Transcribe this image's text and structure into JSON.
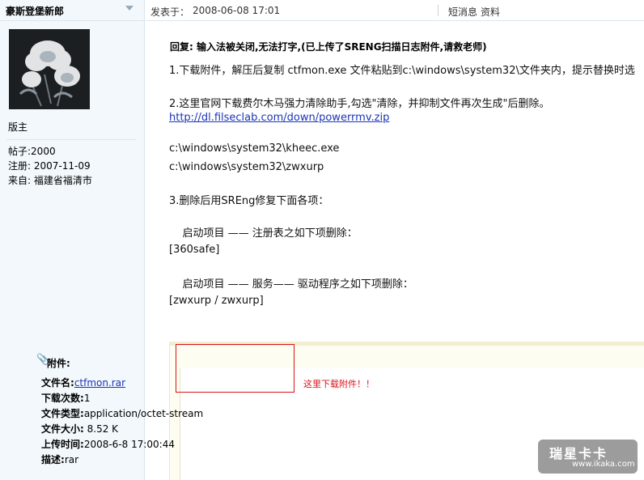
{
  "sidebar": {
    "username": "豪斯登堡新郎",
    "rank": "版主",
    "stats": [
      {
        "key": "帖子:",
        "value": "2000"
      },
      {
        "key": "注册:",
        "value": "2007-11-09"
      },
      {
        "key": "来自:",
        "value": "福建省福清市"
      }
    ]
  },
  "post": {
    "time_label": "发表于：",
    "time": "2008-06-08 17:01",
    "pm": "短消息",
    "profile": "资料",
    "title": "回复: 输入法被关闭,无法打字,(已上传了SRENG扫描日志附件,请救老师)",
    "lines": [
      "1.下载附件，解压后复制 ctfmon.exe 文件粘贴到c:\\windows\\system32\\文件夹内，提示替换时选",
      "2.这里官网下载费尔木马强力清除助手,勾选\"清除，并抑制文件再次生成\"后删除。",
      "http://dl.filseclab.com/down/powerrmv.zip",
      "c:\\windows\\system32\\kheec.exe",
      "c:\\windows\\system32\\zwxurp",
      "3.删除后用SREng修复下面各项：",
      "    启动项目 —— 注册表之如下项删除：",
      "[360safe]",
      "    启动项目 —— 服务—— 驱动程序之如下项删除：",
      "[zwxurp / zwxurp]"
    ]
  },
  "attachment": {
    "label": "附件:",
    "fields": [
      {
        "key": "文件名:",
        "value": "ctfmon.rar",
        "link": true
      },
      {
        "key": "下载次数:",
        "value": "1"
      },
      {
        "key": "文件类型:",
        "value": "application/octet-stream"
      },
      {
        "key": "文件大小:",
        "value": " 8.52 K"
      },
      {
        "key": "上传时间:",
        "value": "2008-6-8 17:00:44"
      },
      {
        "key": "描述:",
        "value": "rar"
      }
    ],
    "note": "这里下载附件！！"
  },
  "watermark": {
    "title": "瑞星卡卡",
    "url": "www.ikaka.com"
  },
  "colors": {
    "sidebar_bg": "#f2f8fc",
    "link": "#1a35b8",
    "highlight_red": "#d9121b",
    "attach_bg": "#fdfdf2"
  }
}
